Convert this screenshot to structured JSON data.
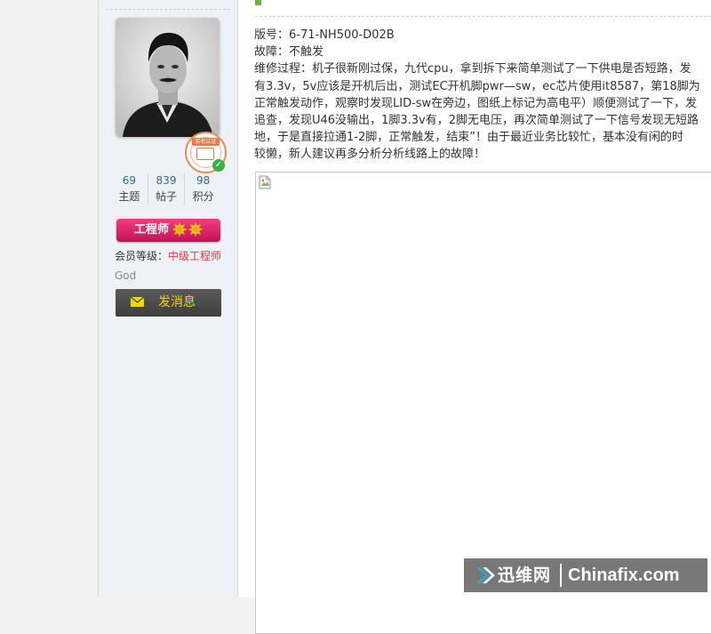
{
  "profile": {
    "cert_badge": "实名认证",
    "stats": [
      {
        "value": "69",
        "label": "主题"
      },
      {
        "value": "839",
        "label": "帖子"
      },
      {
        "value": "98",
        "label": "积分"
      }
    ],
    "role": "工程师",
    "member_level_label": "会员等级：",
    "member_level_value": "中级工程师",
    "custom_title": "God",
    "message_button": "发消息"
  },
  "post": {
    "lines": [
      "版号：6-71-NH500-D02B",
      "故障：不触发",
      "维修过程：机子很新刚过保，九代cpu，拿到拆下来简单测试了一下供电是否短路，发",
      "有3.3v，5v应该是开机后出，测试EC开机脚pwr—sw，ec芯片使用it8587，第18脚为",
      "正常触发动作，观察时发现LID-sw在旁边，图纸上标记为高电平）顺便测试了一下，发",
      "追查，发现U46没输出，1脚3.3v有，2脚无电压，再次简单测试了一下信号发现无短路",
      "地，于是直接拉通1-2脚，正常触发，结束”！由于最近业务比较忙，基本没有闲的时",
      "较懒，新人建议再多分析分析线路上的故障！"
    ]
  },
  "watermark": {
    "cn": "迅维网",
    "en": "Chinafix.com"
  },
  "colors": {
    "link_blue": "#336699",
    "level_red": "#e4393c",
    "badge_pink": "#e0236a",
    "msg_yellow": "#f6d800"
  }
}
